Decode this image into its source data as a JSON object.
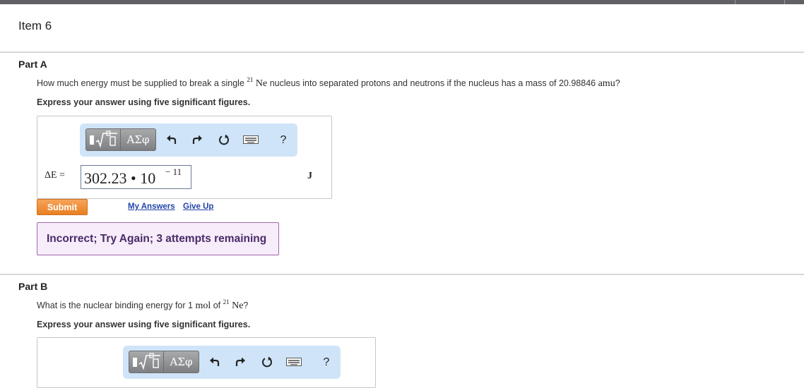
{
  "item_title": "Item 6",
  "toolbar": {
    "templates_icon": "fraction-root-templates-icon",
    "greek_label": "ΑΣφ",
    "undo_icon": "undo-icon",
    "redo_icon": "redo-icon",
    "reset_icon": "reset-icon",
    "keyboard_icon": "keyboard-icon",
    "help_label": "?"
  },
  "part_a": {
    "title": "Part A",
    "question_pre": "How much energy must be supplied to break a single ",
    "isotope_mass_number": "21",
    "isotope_symbol": "Ne",
    "question_mid": " nucleus into separated protons and neutrons if the nucleus has a mass of 20.98846 ",
    "mass_unit": "amu",
    "question_post": "?",
    "instruction": "Express your answer using five significant figures.",
    "variable_label": "ΔE =",
    "answer_mantissa": "302.23 • 10",
    "answer_exponent": "− 11",
    "unit": "J",
    "submit_label": "Submit",
    "my_answers_label": "My Answers",
    "give_up_label": "Give Up",
    "feedback": "Incorrect; Try Again; 3 attempts remaining"
  },
  "part_b": {
    "title": "Part B",
    "question_pre": "What is the nuclear binding energy for 1 ",
    "mol_unit": "mol",
    "question_mid": " of ",
    "isotope_mass_number": "21",
    "isotope_symbol": "Ne",
    "question_post": "?",
    "instruction": "Express your answer using five significant figures."
  },
  "colors": {
    "toolbar_bg": "#cfe4f8",
    "submit_orange": "#ea7f22",
    "feedback_bg": "#f7ecf9",
    "feedback_border": "#a367ad",
    "link_blue": "#2244a8"
  }
}
